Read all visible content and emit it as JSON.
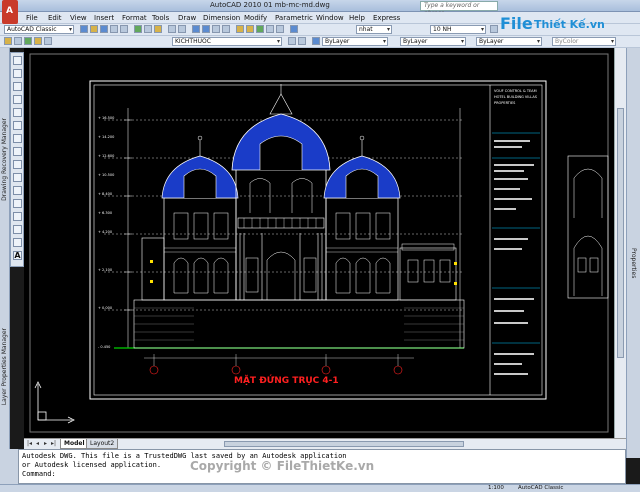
{
  "window": {
    "title": "AutoCAD 2010    01 mb-mc-md.dwg",
    "search_placeholder": "Type a keyword or phrase"
  },
  "app_button_letter": "A",
  "menu": [
    "File",
    "Edit",
    "View",
    "Insert",
    "Format",
    "Tools",
    "Draw",
    "Dimension",
    "Modify",
    "Parametric",
    "Window",
    "Help",
    "Express"
  ],
  "toolbar": {
    "workspace": "AutoCAD Classic",
    "text_style": "KICHTHUOC",
    "layer": "ByLayer",
    "dim_style": "nhat",
    "dim_value": "10 NH",
    "linetype": "ByLayer",
    "lineweight": "ByLayer",
    "plot_style": "ByColor"
  },
  "palettes": {
    "drawing_recovery": "Drawing Recovery Manager",
    "layer_properties": "Layer Properties Manager",
    "properties": "Properties"
  },
  "drawing": {
    "caption": "MẶT ĐỨNG TRỤC 4-1",
    "title_block_lines": [
      "VOUF CONTROL & TEAM",
      "HOTEL BUILDING VILLAS",
      "PROPERTIES"
    ],
    "level_labels": [
      "+ 16.500",
      "+ 14.200",
      "+ 12.600",
      "+ 10.500",
      "+ 8.400",
      "+ 6.300",
      "+ 4.200",
      "+ 2.100",
      "+ 0.000",
      "- 0.450"
    ]
  },
  "tabs": [
    {
      "label": "Model",
      "active": true
    },
    {
      "label": "Layout2",
      "active": false
    }
  ],
  "command": {
    "history": [
      "Autodesk DWG.  This file is a TrustedDWG last saved by an Autodesk application",
      "or Autodesk licensed application."
    ],
    "prompt": "Command:"
  },
  "status": {
    "scale": "1:100",
    "workspace": "AutoCAD Classic"
  },
  "watermark": {
    "logo_file": "File",
    "logo_rest": "Thiết Kế.vn",
    "copyright": "Copyright © FileThietKe.vn"
  },
  "colors": {
    "canvas": "#000000",
    "cad_white": "#ffffff",
    "cad_cyan": "#00c8ff",
    "cad_yellow": "#ffe000",
    "cad_red": "#ff2020",
    "cad_green": "#00d000",
    "roof_blue": "#1a3cc8"
  }
}
